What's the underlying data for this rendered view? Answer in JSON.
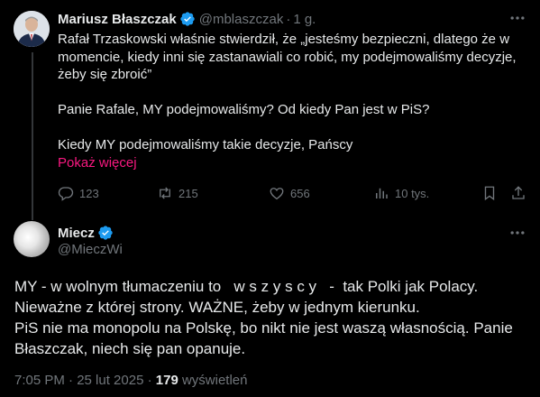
{
  "tweet1": {
    "author_name": "Mariusz Błaszczak",
    "handle": "@mblaszczak",
    "separator": "·",
    "time": "1 g.",
    "verified_icon": "verified-badge-icon",
    "lines": [
      "Rafał Trzaskowski właśnie stwierdził, że „jesteśmy bezpieczni, dlatego że w momencie, kiedy inni się zastanawiali co robić, my podejmowaliśmy decyzje, żeby się zbroić”",
      "Panie Rafale, MY podejmowaliśmy? Od kiedy Pan jest w PiS?",
      "Kiedy MY podejmowaliśmy takie decyzje, Pańscy"
    ],
    "show_more": "Pokaż więcej",
    "replies": "123",
    "retweets": "215",
    "likes": "656",
    "views": "10 tys."
  },
  "tweet2": {
    "author_name": "Miecz",
    "handle": "@MieczWi",
    "lines": [
      "MY - w wolnym tłumaczeniu to   w s z y s c y   -  tak Polki jak Polacy.",
      "Nieważne z której strony. WAŻNE, żeby w jednym kierunku.",
      "PiS nie ma monopolu na Polskę, bo nikt nie jest waszą własnością. Panie Błaszczak, niech się pan opanuje."
    ],
    "timestamp": "7:05 PM · 25 lut 2025 · ",
    "views_count": "179",
    "views_label": " wyświetleń"
  },
  "colors": {
    "background": "#000000",
    "text": "#e7e9ea",
    "secondary": "#71767b",
    "accent_pink": "#f91880",
    "verified_blue": "#1d9bf0"
  }
}
